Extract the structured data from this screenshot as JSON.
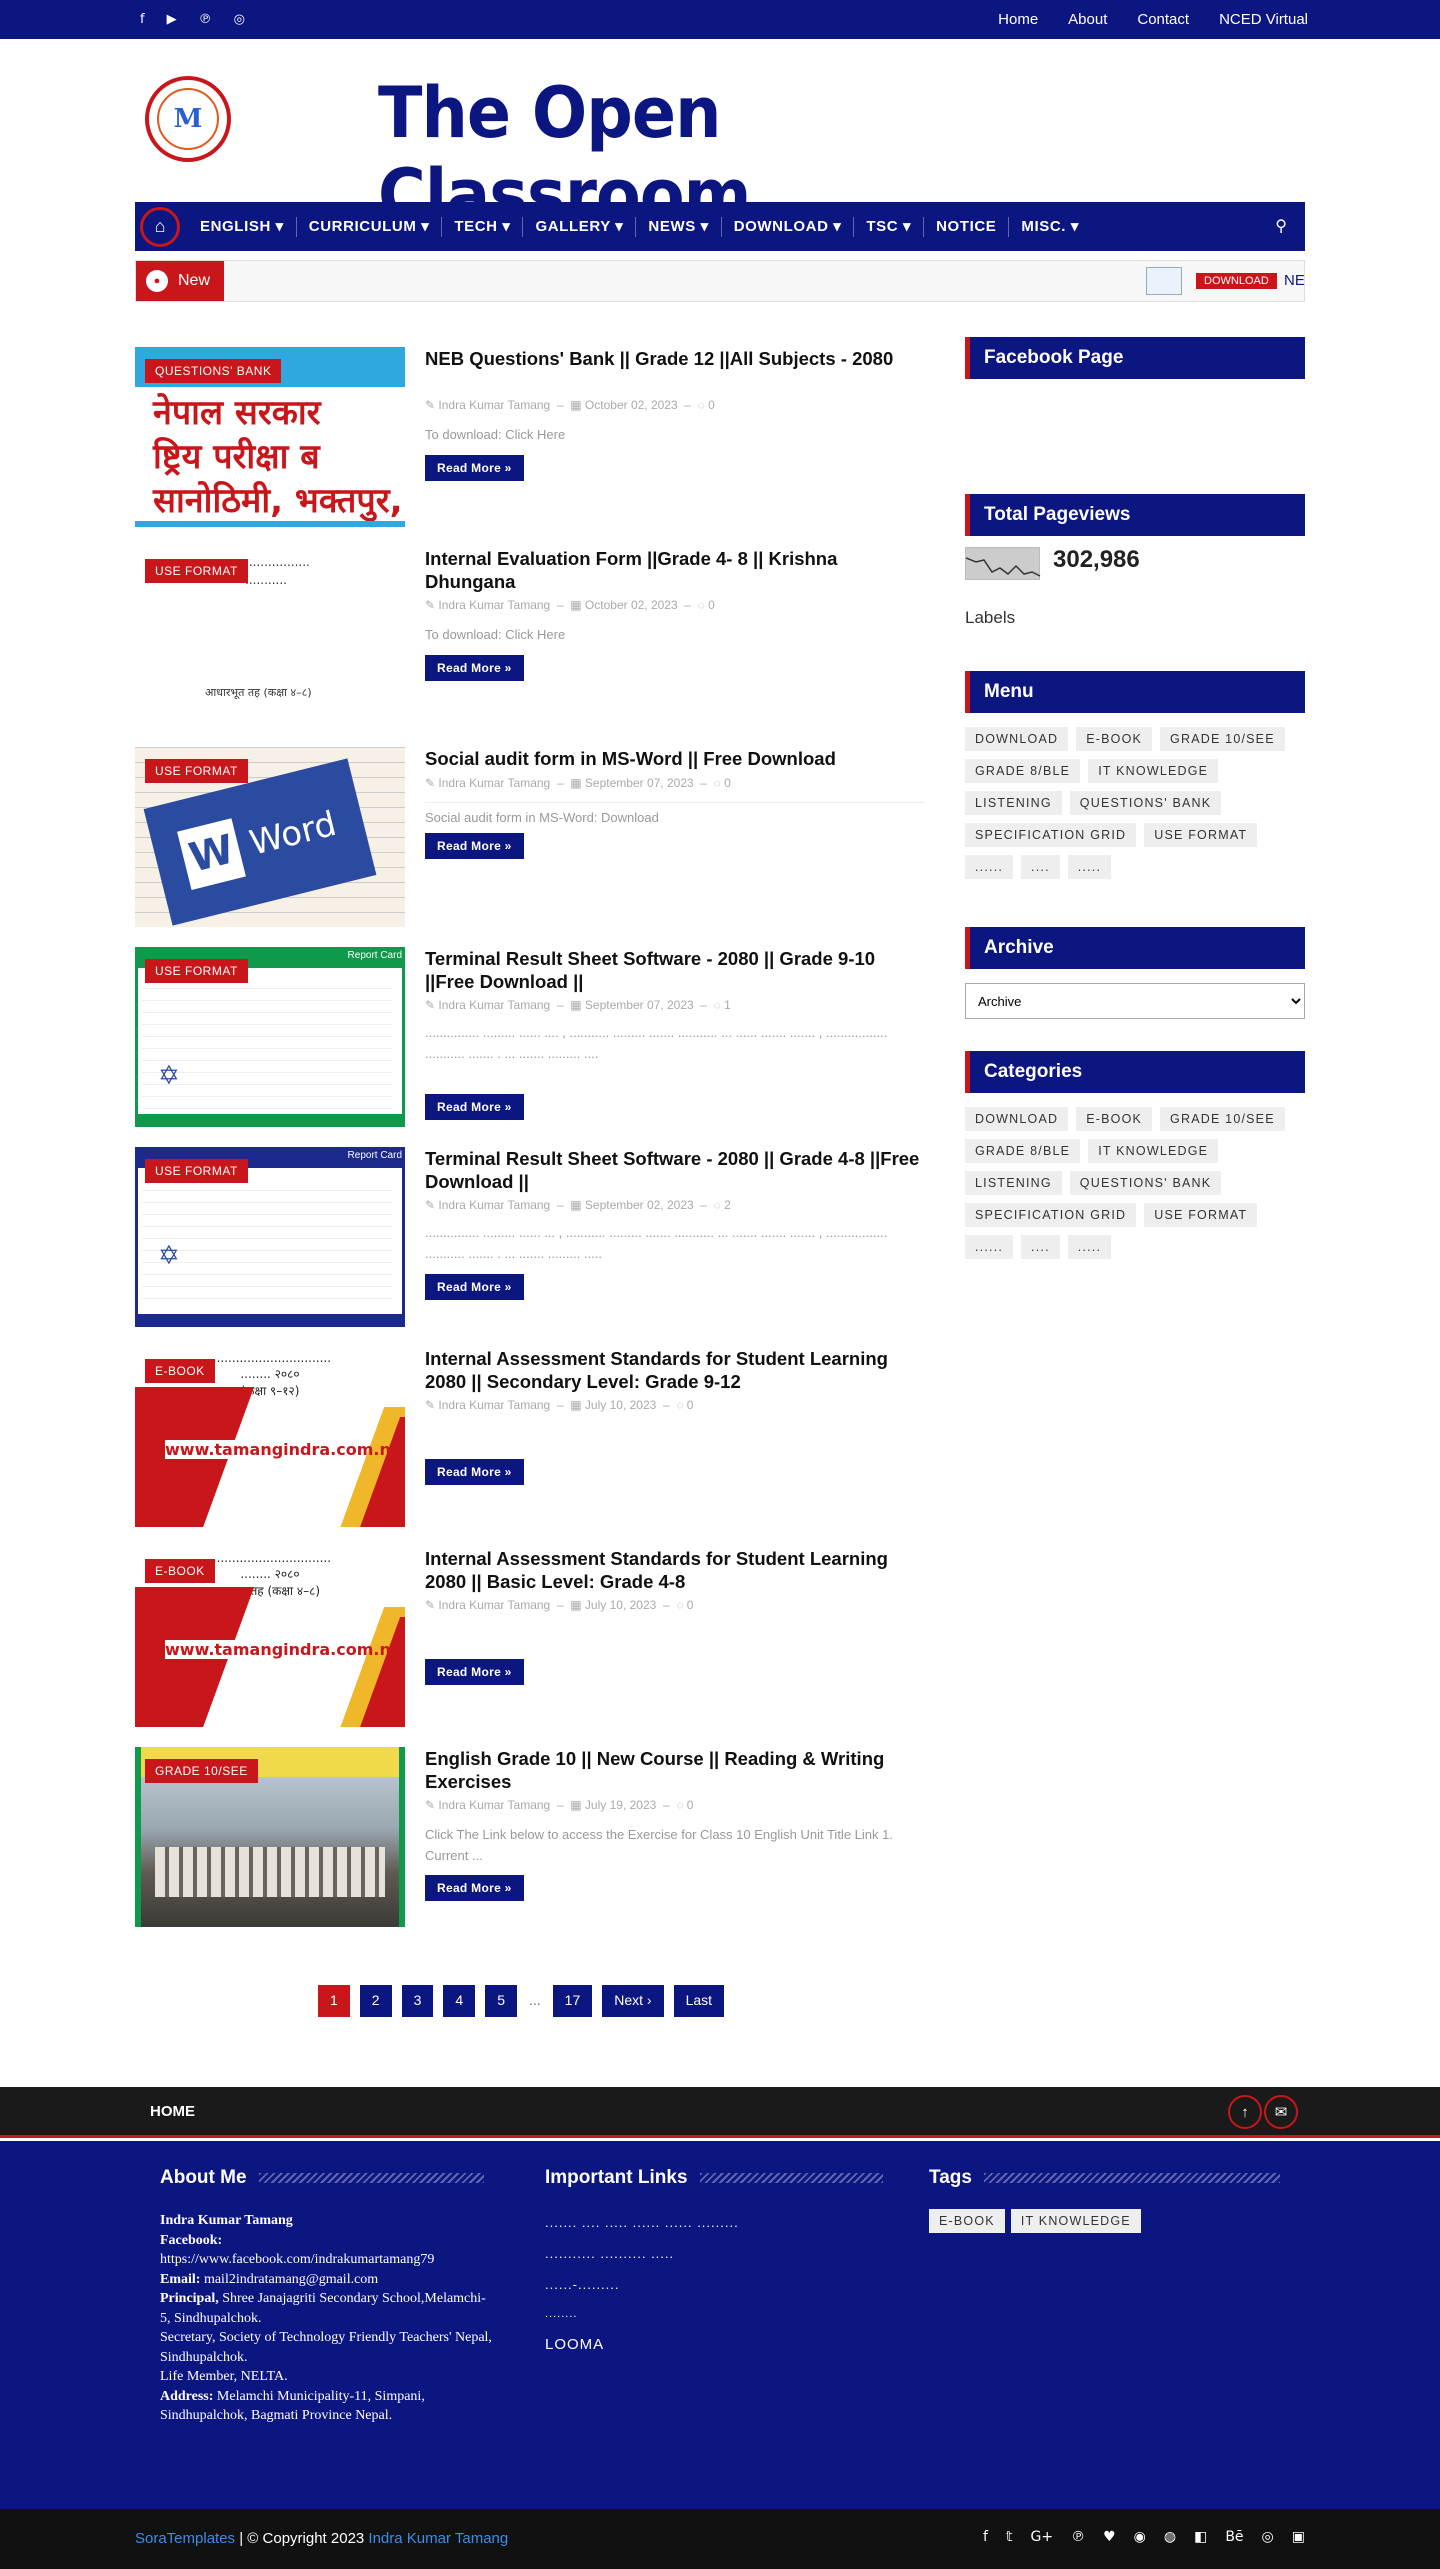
{
  "topbar": {
    "social_icons": [
      "facebook-icon",
      "youtube-icon",
      "pinterest-icon",
      "instagram-icon"
    ],
    "social_glyphs": [
      "f",
      "▶",
      "℗",
      "◎"
    ],
    "links": [
      "Home",
      "About",
      "Contact",
      "NCED Virtual"
    ]
  },
  "header": {
    "title": "The Open Classroom",
    "logo_mark": "M"
  },
  "nav": {
    "items": [
      "ENGLISH ▾",
      "CURRICULUM ▾",
      "TECH ▾",
      "GALLERY ▾",
      "NEWS ▾",
      "DOWNLOAD ▾",
      "TSC ▾",
      "NOTICE",
      "MISC. ▾"
    ]
  },
  "ticker": {
    "label": "New",
    "badge": "DOWNLOAD",
    "text": "NE"
  },
  "posts": [
    {
      "label": "QUESTIONS' BANK",
      "title": "NEB Questions' Bank || Grade 12 ||All Subjects - 2080",
      "author": "Indra Kumar Tamang",
      "date": "October 02, 2023",
      "comments": "0",
      "snippet": "To download:   Click Here",
      "more": "Read More »",
      "image_text": "नेपाल सरकार\nष्ट्रिय परीक्षा ब\nसानोठिमी, भक्तपुर, नेपाल"
    },
    {
      "label": "USE FORMAT",
      "title": "Internal Evaluation Form ||Grade 4- 8 || Krishna Dhungana",
      "author": "Indra Kumar Tamang",
      "date": "October 02, 2023",
      "comments": "0",
      "snippet": "To download:   Click Here",
      "more": "Read More »",
      "image_text": "आधारभूत तह (कक्षा ४–८)"
    },
    {
      "label": "USE FORMAT",
      "title": "Social audit form in MS-Word || Free Download",
      "author": "Indra Kumar Tamang",
      "date": "September 07, 2023",
      "comments": "0",
      "snippet": "  Social audit form in MS-Word:   Download",
      "more": "Read More »",
      "image_text": "Word"
    },
    {
      "label": "USE FORMAT",
      "title": "Terminal Result Sheet Software - 2080 || Grade 9-10 ||Free Download ||",
      "author": "Indra Kumar Tamang",
      "date": "September 07, 2023",
      "comments": "1",
      "snippet": "     ............... ......... ...... .... ,  ........... ......... ....... ........... ... ...... ....... ....... , ................. ........... ....... . ... ....... ......... ....",
      "more": "Read More »",
      "image_text": "Report Card"
    },
    {
      "label": "USE FORMAT",
      "title": "Terminal Result Sheet Software - 2080 || Grade 4-8 ||Free Download ||",
      "author": "Indra Kumar Tamang",
      "date": "September 02, 2023",
      "comments": "2",
      "snippet": "  ............... ......... ...... ... , ........... ......... ....... ........... ... ....... ....... ....... , ................. ........... ....... . ... ....... ......... .....",
      "more": "Read More »",
      "image_text": "Report Card"
    },
    {
      "label": "E-BOOK",
      "title": "Internal Assessment Standards for Student Learning 2080 || Secondary Level: Grade 9-12",
      "author": "Indra Kumar Tamang",
      "date": "July 10, 2023",
      "comments": "0",
      "snippet": "",
      "more": "Read More »",
      "image_text": "www.tamangindra.com.np"
    },
    {
      "label": "E-BOOK",
      "title": "Internal Assessment Standards for Student Learning 2080 || Basic Level: Grade 4-8",
      "author": "Indra Kumar Tamang",
      "date": "July 10, 2023",
      "comments": "0",
      "snippet": "",
      "more": "Read More »",
      "image_text": "www.tamangindra.com.np"
    },
    {
      "label": "GRADE 10/SEE",
      "title": "English Grade 10 || New Course || Reading & Writing Exercises",
      "author": "Indra Kumar Tamang",
      "date": "July 19, 2023",
      "comments": "0",
      "snippet": "Click The Link below to access the Exercise for Class 10 English Unit Title Link 1. Current ...",
      "more": "Read More »",
      "image_text": ""
    }
  ],
  "pager": [
    "1",
    "2",
    "3",
    "4",
    "5",
    "...",
    "17",
    "Next ›",
    "Last"
  ],
  "sidebar": {
    "facebook_title": "Facebook Page",
    "pageviews_title": "Total Pageviews",
    "pageviews": "302,986",
    "labels_title": "Labels",
    "menu_title": "Menu",
    "menu_tags": [
      "DOWNLOAD",
      "E-BOOK",
      "GRADE 10/SEE",
      "GRADE 8/BLE",
      "IT KNOWLEDGE",
      "LISTENING",
      "QUESTIONS' BANK",
      "SPECIFICATION GRID",
      "USE FORMAT",
      "......",
      "....",
      "....."
    ],
    "archive_title": "Archive",
    "archive_value": "Archive",
    "categories_title": "Categories",
    "categories": [
      "DOWNLOAD",
      "E-BOOK",
      "GRADE 10/SEE",
      "GRADE 8/BLE",
      "IT KNOWLEDGE",
      "LISTENING",
      "QUESTIONS' BANK",
      "SPECIFICATION GRID",
      "USE FORMAT",
      "......",
      "....",
      "....."
    ]
  },
  "footbar": {
    "home": "HOME"
  },
  "footer": {
    "about_title": "About Me",
    "links_title": "Important Links",
    "tags_title": "Tags",
    "name": "Indra Kumar Tamang",
    "facebook_label": "Facebook:",
    "facebook_url": "https://www.facebook.com/indrakumartamang79",
    "email_label": "Email:",
    "email": "mail2indratamang@gmail.com",
    "principal_label": "Principal,",
    "principal": "Shree Janajagriti Secondary School,Melamchi-5, Sindhupalchok.",
    "secretary": "Secretary, Society of Technology Friendly Teachers' Nepal, Sindhupalchok.",
    "life": "Life Member, NELTA.",
    "address_label": "Address:",
    "address": "Melamchi Municipality-11, Simpani, Sindhupalchok, Bagmati Province Nepal.",
    "links": [
      "....... .... ..... ...... ...... .........",
      "........... .......... .....",
      "......-.........",
      "........",
      "LOOMA"
    ],
    "tags": [
      "E-BOOK",
      "IT KNOWLEDGE"
    ]
  },
  "bottom": {
    "brand": "SoraTemplates",
    "copy": " | © Copyright 2023 ",
    "owner": "Indra Kumar Tamang",
    "social": [
      "f",
      "𝕥",
      "G+",
      "℗",
      "♥",
      "◉",
      "◍",
      "◧",
      "Bē",
      "◎",
      "▣"
    ]
  },
  "colors": {
    "primary": "#0c1680",
    "accent": "#c9161b"
  }
}
